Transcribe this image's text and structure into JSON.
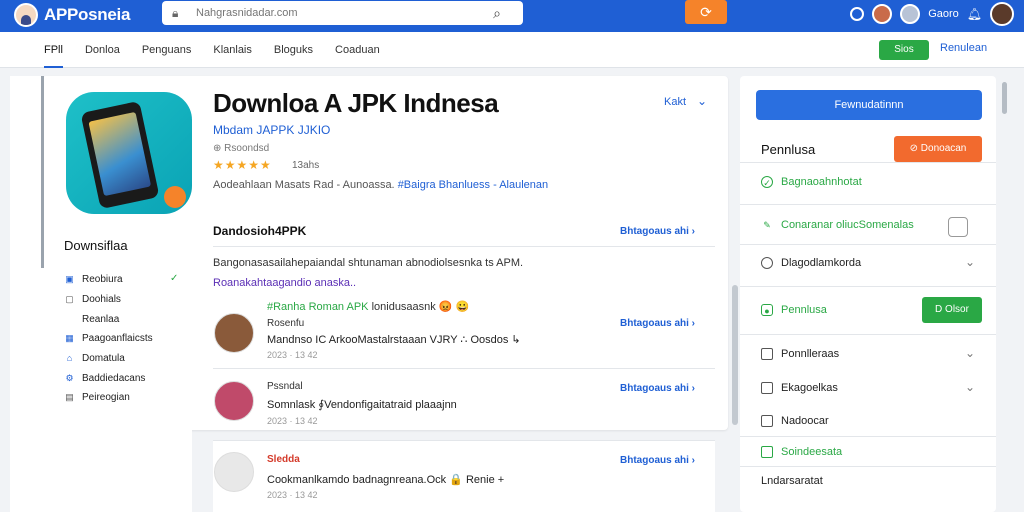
{
  "topbar": {
    "logo_text": "APPosneia",
    "search_placeholder": "Nahgrasnidadar.com",
    "user_label": "Gaoro"
  },
  "nav": {
    "tabs": [
      "FPll",
      "Donloa",
      "Penguans",
      "Klanlais",
      "Bloguks",
      "Coaduan"
    ],
    "green_button": "Sios",
    "link": "Renulean"
  },
  "app": {
    "title": "Downloa A JPK Indnesa",
    "subtitle": "Mbdam JAPPK JJKIO",
    "meta": "Rsoondsd",
    "stars": "★★★★★",
    "rating_count": "13ahs",
    "tagline_plain": "Aodeahlaan Masats Rad - Aunoassa.",
    "tagline_tags": "#Baigra Bhanluess - Alaulenan",
    "kakt": "Kakt"
  },
  "description": {
    "heading": "Dandosioh4PPK",
    "link": "Bhtagoaus ahi",
    "line1": "Bangonasasailahepaiandal shtunaman abnodiolsesnka ts APM.",
    "line2": "Roanakahtaagandio anaska..",
    "review_tag": "#Ranha Roman APK",
    "review_tag_rest": "lonidusaasnk 😡 😀"
  },
  "reviews": [
    {
      "name": "Rosenfu",
      "text": "Mandnso IC ArkooMastalrstaaan VJRY ∴ Oosdos ↳",
      "date": "2023 · 13 42",
      "link": "Bhtagoaus ahi"
    },
    {
      "name": "Pssndal",
      "text": "Somnlask ∮Vendonfigaitatraid plaaajnn",
      "date": "2023 · 13 42",
      "link": "Bhtagoaus ahi"
    },
    {
      "name": "Sledda",
      "text": "Cookmanlkamdo badnagnreana.Ock 🔒 Renie +",
      "date": "2023 · 13 42",
      "link": "Bhtagoaus ahi"
    }
  ],
  "sidebar": {
    "heading": "Downsiflaa",
    "items": [
      "Reobiura",
      "Doohials",
      "Reanlaa",
      "Paagoanflaicsts",
      "Domatula",
      "Baddiedacans",
      "Peireogian"
    ]
  },
  "rpanel": {
    "primary_button": "Fewnudatinnn",
    "heading": "Pennlusa",
    "orange_button": "Donoacan",
    "rows": [
      {
        "label": "Bagnaoahnhotat",
        "style": "green"
      },
      {
        "label": "Conaranar oliucSomenalas",
        "style": "green"
      },
      {
        "label": "Dlagodlamkorda",
        "style": "dark"
      },
      {
        "label": "Pennlusa",
        "style": "green"
      },
      {
        "label": "Ponnlleraas",
        "style": "dark"
      },
      {
        "label": "Ekagoelkas",
        "style": "dark"
      },
      {
        "label": "Nadoocar",
        "style": "dark"
      },
      {
        "label": "Soindeesata",
        "style": "green"
      }
    ],
    "green_button": "D Olsor",
    "plain": "Lndarsaratat"
  }
}
